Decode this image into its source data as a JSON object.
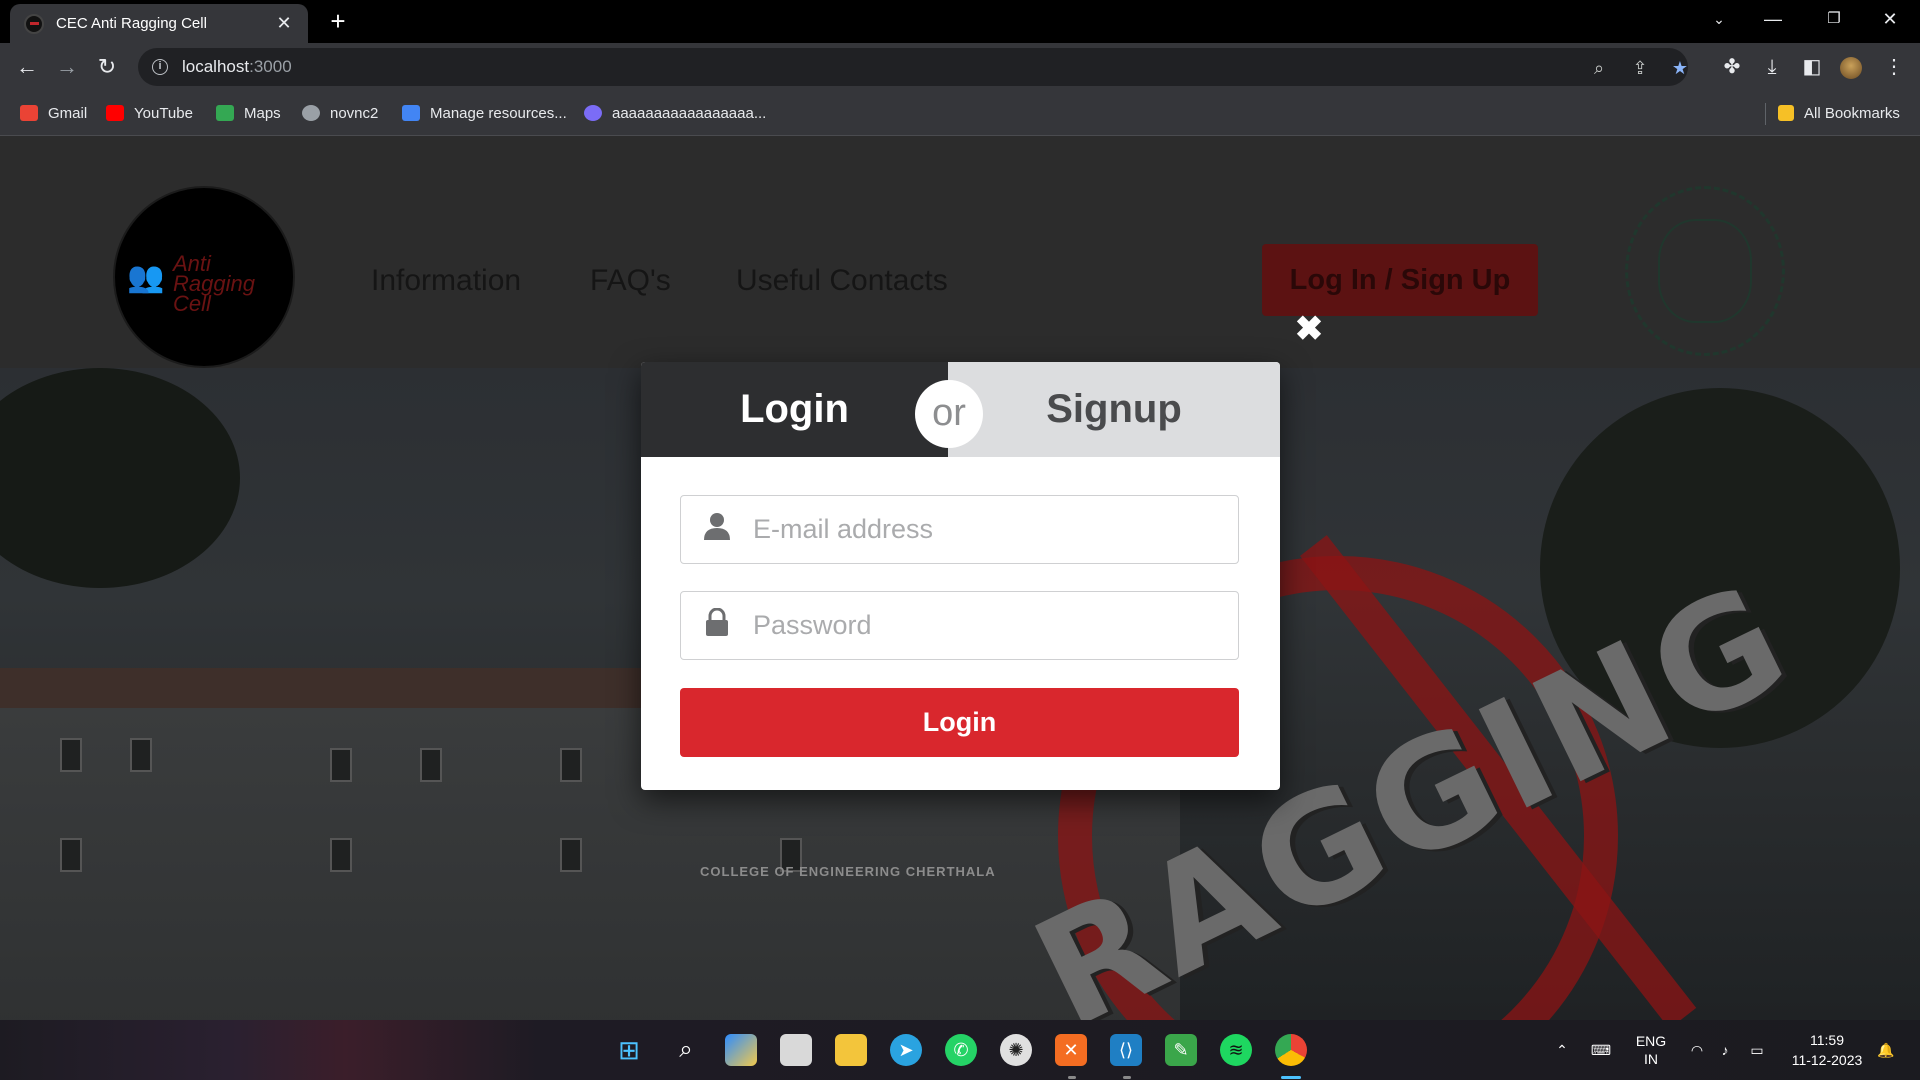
{
  "browser": {
    "tab_title": "CEC Anti Ragging Cell",
    "url_host": "localhost",
    "url_port": ":3000",
    "bookmarks": [
      {
        "label": "Gmail",
        "color": "#ea4335"
      },
      {
        "label": "YouTube",
        "color": "#ff0000"
      },
      {
        "label": "Maps",
        "color": "#34a853"
      },
      {
        "label": "novnc2",
        "color": "#9aa0a6"
      },
      {
        "label": "Manage resources...",
        "color": "#4285f4"
      },
      {
        "label": "aaaaaaaaaaaaaaaaa...",
        "color": "#7b6cf6"
      }
    ],
    "all_bookmarks": "All Bookmarks"
  },
  "site": {
    "logo_text": "Anti Ragging Cell",
    "nav": [
      "Information",
      "FAQ's",
      "Useful Contacts"
    ],
    "cta": "Log In / Sign Up",
    "hero_text": "RAGGING",
    "college_sign": "COLLEGE OF ENGINEERING CHERTHALA"
  },
  "modal": {
    "close_symbol": "✖",
    "tab_login": "Login",
    "tab_or": "or",
    "tab_signup": "Signup",
    "email_placeholder": "E-mail address",
    "password_placeholder": "Password",
    "submit": "Login"
  },
  "taskbar": {
    "lang_top": "ENG",
    "lang_bottom": "IN",
    "time": "11:59",
    "date": "11-12-2023"
  }
}
